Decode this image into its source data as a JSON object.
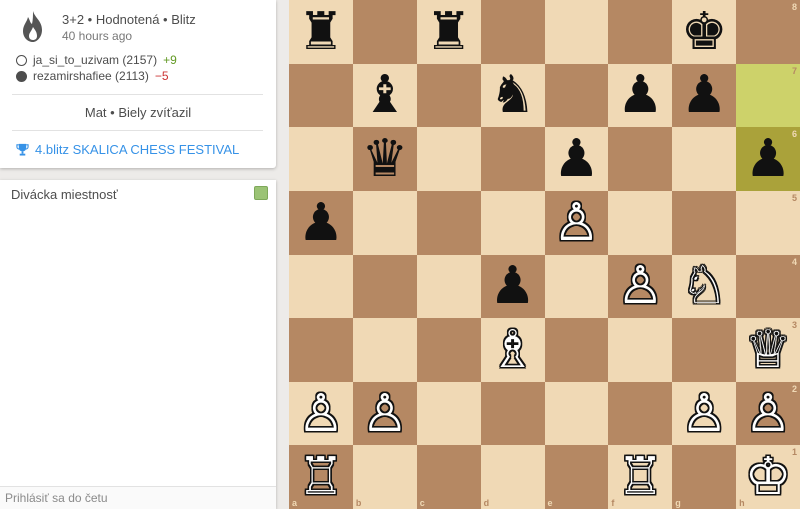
{
  "game": {
    "meta": "3+2 • Hodnotená • Blitz",
    "time_ago": "40 hours ago",
    "white_player": "ja_si_to_uzivam (2157)",
    "white_diff": "+9",
    "black_player": "rezamirshafiee (2113)",
    "black_diff": "−5",
    "result": "Mat • Biely zvíťazil",
    "tournament": "4.blitz SKALICA CHESS FESTIVAL"
  },
  "chat": {
    "title": "Divácka miestnosť",
    "input_placeholder": "Prihlásiť sa do četu"
  },
  "board": {
    "colors": {
      "light": "#f0d9b5",
      "dark": "#b58863",
      "highlight_light": "#cdd26a",
      "highlight_dark": "#aaa23a"
    },
    "files": [
      "a",
      "b",
      "c",
      "d",
      "e",
      "f",
      "g",
      "h"
    ],
    "ranks": [
      "8",
      "7",
      "6",
      "5",
      "4",
      "3",
      "2",
      "1"
    ],
    "last_move": [
      "h7",
      "h6"
    ],
    "pieces": [
      {
        "sq": "a8",
        "color": "b",
        "type": "rook"
      },
      {
        "sq": "c8",
        "color": "b",
        "type": "rook"
      },
      {
        "sq": "g8",
        "color": "b",
        "type": "king"
      },
      {
        "sq": "b7",
        "color": "b",
        "type": "bishop"
      },
      {
        "sq": "d7",
        "color": "b",
        "type": "knight"
      },
      {
        "sq": "f7",
        "color": "b",
        "type": "pawn"
      },
      {
        "sq": "g7",
        "color": "b",
        "type": "pawn"
      },
      {
        "sq": "b6",
        "color": "b",
        "type": "queen"
      },
      {
        "sq": "e6",
        "color": "b",
        "type": "pawn"
      },
      {
        "sq": "h6",
        "color": "b",
        "type": "pawn"
      },
      {
        "sq": "a5",
        "color": "b",
        "type": "pawn"
      },
      {
        "sq": "e5",
        "color": "w",
        "type": "pawn"
      },
      {
        "sq": "d4",
        "color": "b",
        "type": "pawn"
      },
      {
        "sq": "f4",
        "color": "w",
        "type": "pawn"
      },
      {
        "sq": "g4",
        "color": "w",
        "type": "knight"
      },
      {
        "sq": "d3",
        "color": "w",
        "type": "bishop"
      },
      {
        "sq": "h3",
        "color": "w",
        "type": "queen"
      },
      {
        "sq": "a2",
        "color": "w",
        "type": "pawn"
      },
      {
        "sq": "b2",
        "color": "w",
        "type": "pawn"
      },
      {
        "sq": "g2",
        "color": "w",
        "type": "pawn"
      },
      {
        "sq": "h2",
        "color": "w",
        "type": "pawn"
      },
      {
        "sq": "a1",
        "color": "w",
        "type": "rook"
      },
      {
        "sq": "f1",
        "color": "w",
        "type": "rook"
      },
      {
        "sq": "h1",
        "color": "w",
        "type": "king"
      }
    ]
  }
}
